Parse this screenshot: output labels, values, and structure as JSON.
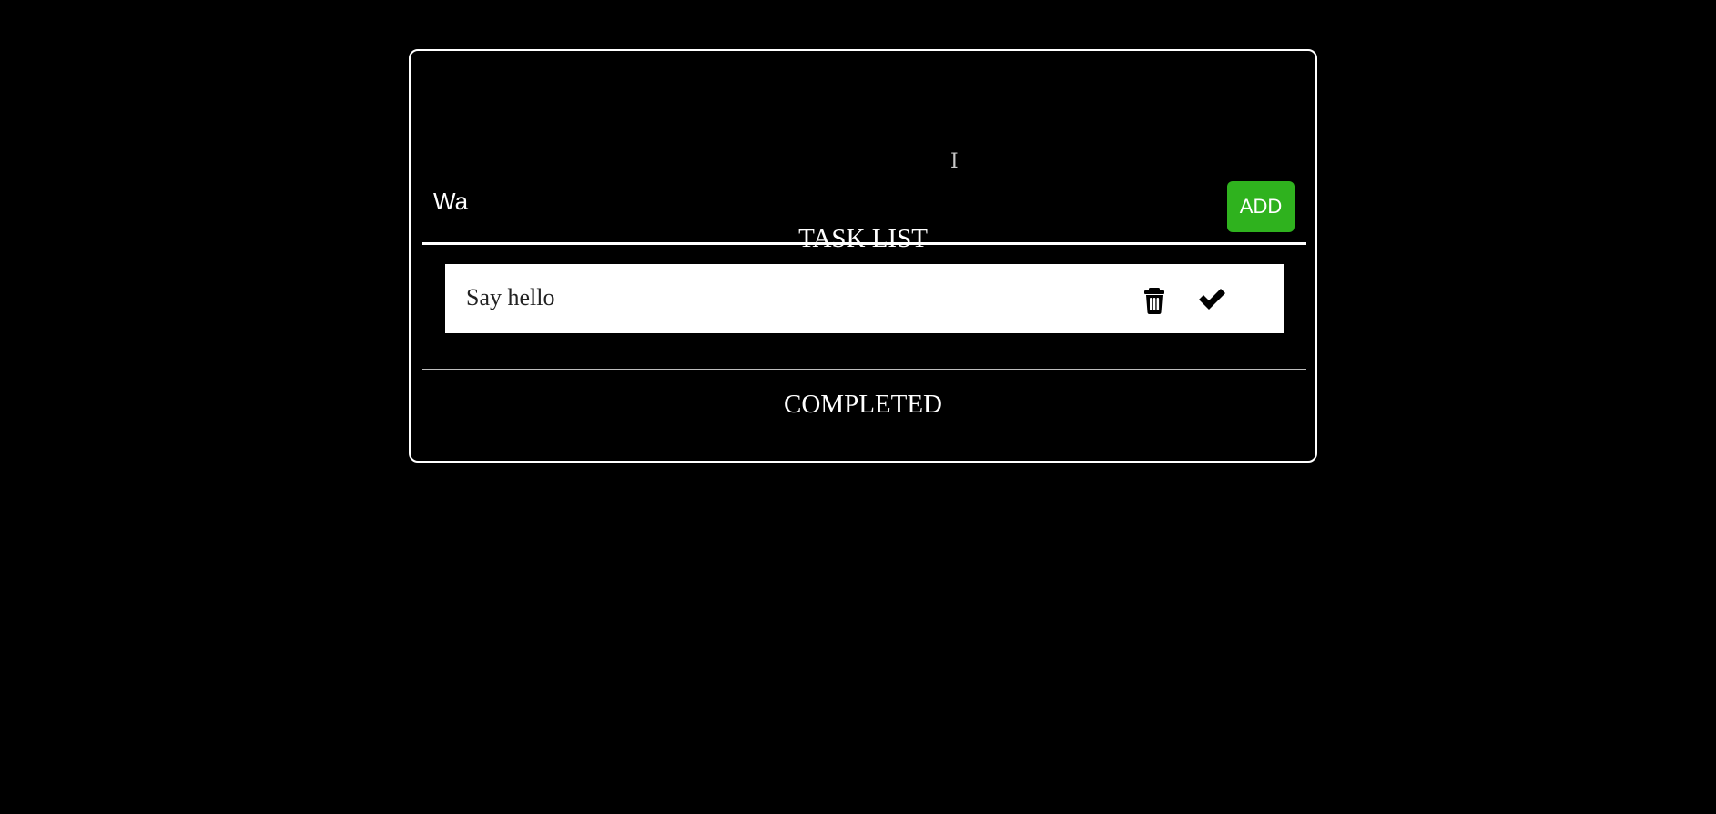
{
  "input": {
    "value": "Wa",
    "placeholder": ""
  },
  "add_button": {
    "label": "ADD",
    "color": "#2fb21e"
  },
  "task_list": {
    "title": "TASK LIST",
    "items": [
      {
        "text": "Say hello",
        "delete_icon": "trash-icon",
        "complete_icon": "checkmark-icon"
      }
    ]
  },
  "completed": {
    "title": "COMPLETED",
    "items": []
  },
  "theme": {
    "background": "#000000",
    "foreground": "#ffffff",
    "task_background": "#ffffff"
  }
}
